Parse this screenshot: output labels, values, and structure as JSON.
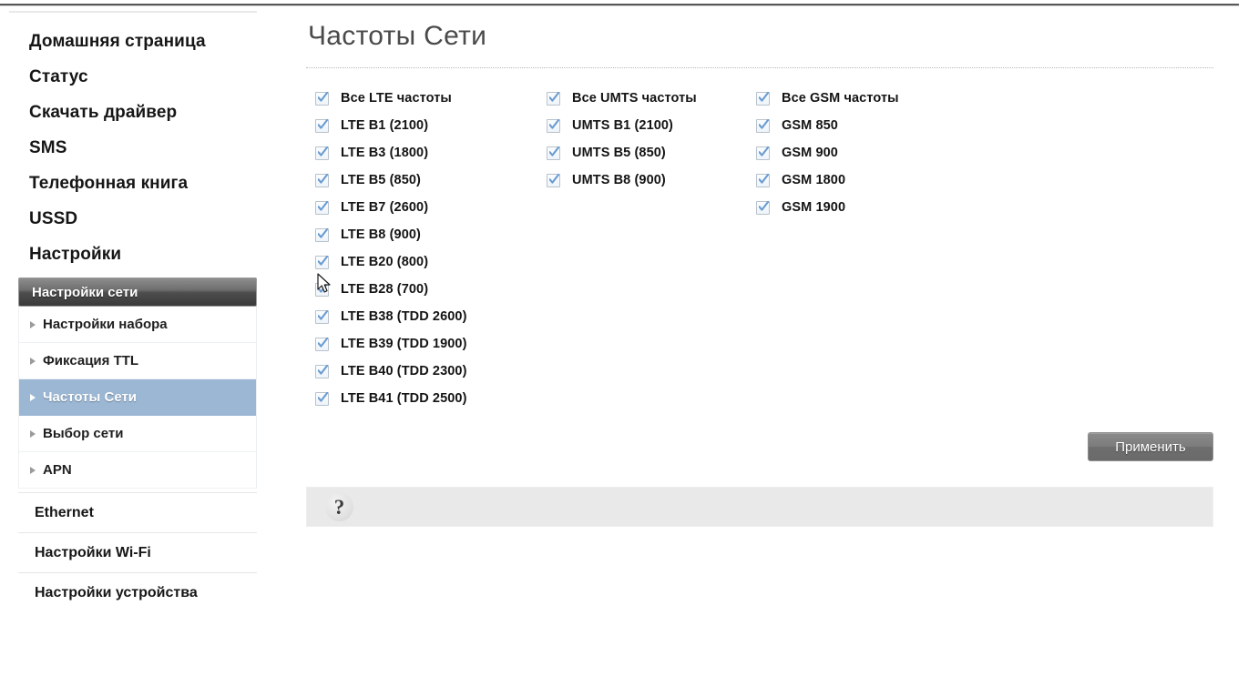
{
  "sidebar": {
    "top_items": [
      {
        "label": "Домашняя страница",
        "name": "sidebar-item-home"
      },
      {
        "label": "Статус",
        "name": "sidebar-item-status"
      },
      {
        "label": "Скачать драйвер",
        "name": "sidebar-item-download-driver"
      },
      {
        "label": "SMS",
        "name": "sidebar-item-sms"
      },
      {
        "label": "Телефонная книга",
        "name": "sidebar-item-phonebook"
      },
      {
        "label": "USSD",
        "name": "sidebar-item-ussd"
      },
      {
        "label": "Настройки",
        "name": "sidebar-item-settings"
      }
    ],
    "group_header": "Настройки сети",
    "sub_items": [
      {
        "label": "Настройки набора",
        "selected": false
      },
      {
        "label": "Фиксация TTL",
        "selected": false
      },
      {
        "label": "Частоты Сети",
        "selected": true
      },
      {
        "label": "Выбор сети",
        "selected": false
      },
      {
        "label": "APN",
        "selected": false
      }
    ],
    "bottom_items": [
      {
        "label": "Ethernet",
        "name": "sidebar-item-ethernet"
      },
      {
        "label": "Настройки Wi-Fi",
        "name": "sidebar-item-wifi-settings"
      },
      {
        "label": "Настройки устройства",
        "name": "sidebar-item-device-settings"
      }
    ]
  },
  "main": {
    "title": "Частоты Сети",
    "columns": [
      {
        "id": "lte",
        "items": [
          {
            "label": "Все LTE частоты",
            "checked": true
          },
          {
            "label": "LTE B1 (2100)",
            "checked": true
          },
          {
            "label": "LTE B3 (1800)",
            "checked": true
          },
          {
            "label": "LTE B5 (850)",
            "checked": true
          },
          {
            "label": "LTE B7 (2600)",
            "checked": true
          },
          {
            "label": "LTE B8 (900)",
            "checked": true
          },
          {
            "label": "LTE B20 (800)",
            "checked": true
          },
          {
            "label": "LTE B28 (700)",
            "checked": true
          },
          {
            "label": "LTE B38 (TDD 2600)",
            "checked": true
          },
          {
            "label": "LTE B39 (TDD 1900)",
            "checked": true
          },
          {
            "label": "LTE B40 (TDD 2300)",
            "checked": true
          },
          {
            "label": "LTE B41 (TDD 2500)",
            "checked": true
          }
        ]
      },
      {
        "id": "umts",
        "items": [
          {
            "label": "Все UMTS частоты",
            "checked": true
          },
          {
            "label": "UMTS B1 (2100)",
            "checked": true
          },
          {
            "label": "UMTS B5 (850)",
            "checked": true
          },
          {
            "label": "UMTS B8 (900)",
            "checked": true
          }
        ]
      },
      {
        "id": "gsm",
        "items": [
          {
            "label": "Все GSM частоты",
            "checked": true
          },
          {
            "label": "GSM 850",
            "checked": true
          },
          {
            "label": "GSM 900",
            "checked": true
          },
          {
            "label": "GSM 1800",
            "checked": true
          },
          {
            "label": "GSM 1900",
            "checked": true
          }
        ]
      }
    ],
    "apply_label": "Применить",
    "help_icon": "question-mark-icon",
    "help_text": ""
  },
  "colors": {
    "selection_blue": "#9bb7d4",
    "checkbox_tick": "#6a9bd1",
    "title_gray": "#4a4a4a",
    "help_bar_bg": "#e9e9e9",
    "button_gray": "#7c7c7c"
  }
}
